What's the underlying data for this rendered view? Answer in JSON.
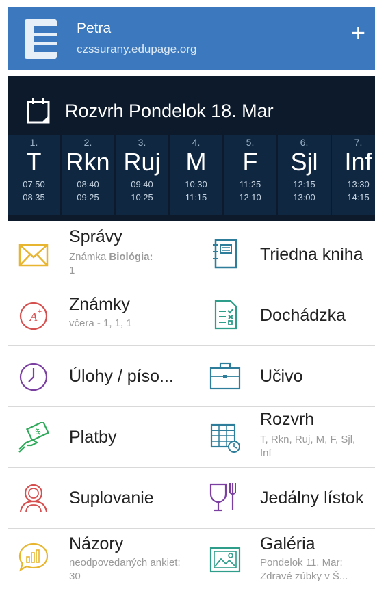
{
  "header": {
    "user_name": "Petra",
    "school": "czssurany.edupage.org",
    "add_label": "+",
    "logo_letter": "E",
    "color": "#3b78bd"
  },
  "timetable": {
    "title": "Rozvrh Pondelok 18. Mar",
    "icon": "calendar-icon",
    "lessons": [
      {
        "num": "1.",
        "subject": "T",
        "start": "07:50",
        "end": "08:35"
      },
      {
        "num": "2.",
        "subject": "Rkn",
        "start": "08:40",
        "end": "09:25"
      },
      {
        "num": "3.",
        "subject": "Ruj",
        "start": "09:40",
        "end": "10:25"
      },
      {
        "num": "4.",
        "subject": "M",
        "start": "10:30",
        "end": "11:15"
      },
      {
        "num": "5.",
        "subject": "F",
        "start": "11:25",
        "end": "12:10"
      },
      {
        "num": "6.",
        "subject": "Sjl",
        "start": "12:15",
        "end": "13:00"
      },
      {
        "num": "7.",
        "subject": "Inf",
        "start": "13:30",
        "end": "14:15"
      }
    ]
  },
  "menu": {
    "spravy": {
      "label": "Správy",
      "sub_prefix": "Známka ",
      "sub_bold": "Biológia:",
      "sub_suffix": "1",
      "icon": "envelope-icon"
    },
    "triedna_kniha": {
      "label": "Triedna kniha",
      "icon": "notebook-icon"
    },
    "znamky": {
      "label": "Známky",
      "sub": "včera - 1, 1, 1",
      "icon": "grade-icon"
    },
    "dochadzka": {
      "label": "Dochádzka",
      "icon": "attendance-icon"
    },
    "ulohy": {
      "label": "Úlohy / píso...",
      "icon": "clock-icon"
    },
    "ucivo": {
      "label": "Učivo",
      "icon": "briefcase-icon"
    },
    "platby": {
      "label": "Platby",
      "icon": "payment-icon"
    },
    "rozvrh": {
      "label": "Rozvrh",
      "sub": "T, Rkn, Ruj, M, F, Sjl, Inf",
      "icon": "timetable-icon"
    },
    "suplovanie": {
      "label": "Suplovanie",
      "icon": "substitute-icon"
    },
    "jedalny_listok": {
      "label": "Jedálny lístok",
      "icon": "dining-icon"
    },
    "nazory": {
      "label": "Názory",
      "sub": "neodpovedaných ankiet: 30",
      "icon": "poll-icon"
    },
    "galeria": {
      "label": "Galéria",
      "sub_line1": "Pondelok 11. Mar:",
      "sub_line2": "Zdravé zúbky v Š...",
      "icon": "gallery-icon"
    }
  }
}
